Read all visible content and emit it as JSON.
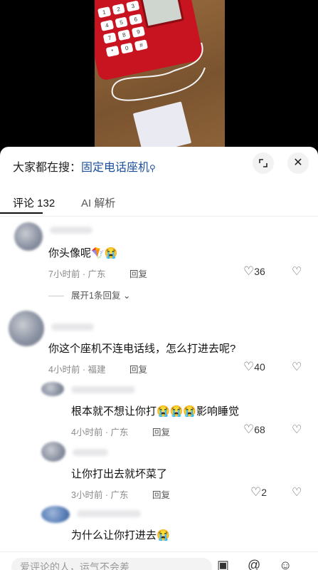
{
  "search": {
    "prefix": "大家都在搜：",
    "keyword": "固定电话座机",
    "icon": "search-icon"
  },
  "tabs": {
    "comments": "评论 132",
    "ai": "AI 解析"
  },
  "keys": [
    "1",
    "2",
    "3",
    "4",
    "5",
    "6",
    "7",
    "8",
    "9",
    "*",
    "0",
    "#"
  ],
  "comments": [
    {
      "text": "你头像呢🪁😭",
      "time": "7小时前 · 广东",
      "reply": "回复",
      "likes": "36",
      "expand": "展开1条回复"
    },
    {
      "text": "你这个座机不连电话线，怎么打进去呢?",
      "time": "4小时前 · 福建",
      "reply": "回复",
      "likes": "40"
    }
  ],
  "replies": [
    {
      "text": "根本就不想让你打😭😭😭影响睡觉",
      "time": "4小时前 · 广东",
      "reply": "回复",
      "likes": "68"
    },
    {
      "text": "让你打出去就坏菜了",
      "time": "3小时前 · 广东",
      "reply": "回复",
      "likes": "2"
    },
    {
      "text": "为什么让你打进去😭"
    }
  ],
  "input": {
    "placeholder": "爱评论的人，运气不会差"
  },
  "icons": {
    "heart": "♡",
    "dislike": "♡"
  }
}
